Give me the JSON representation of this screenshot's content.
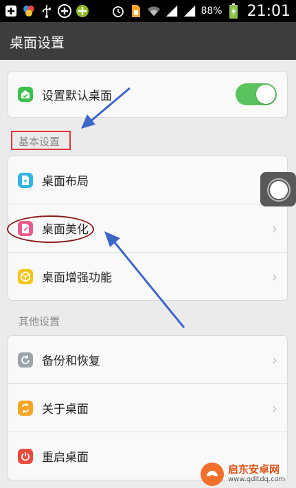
{
  "status_bar": {
    "battery_percent": "88%",
    "time": "21:01",
    "icons": [
      "plus-square-icon",
      "color-dots-icon",
      "usb-icon",
      "plus-circle-icon",
      "game-icon",
      "alarm-icon",
      "sim-icon",
      "wifi-icon",
      "signal-icon",
      "battery-icon"
    ]
  },
  "titlebar": {
    "title": "桌面设置"
  },
  "default_desktop": {
    "label": "设置默认桌面",
    "toggle_on": true,
    "icon": "home-icon",
    "icon_color": "#3cc14b"
  },
  "basic_settings": {
    "header": "基本设置",
    "items": [
      {
        "label": "桌面布局",
        "icon": "layout-icon",
        "color": "#33b5e5"
      },
      {
        "label": "桌面美化",
        "icon": "beautify-icon",
        "color": "#ef5a8a"
      },
      {
        "label": "桌面增强功能",
        "icon": "cube-icon",
        "color": "#f5c518"
      }
    ]
  },
  "other_settings": {
    "header": "其他设置",
    "items": [
      {
        "label": "备份和恢复",
        "icon": "backup-icon",
        "color": "#9aa4ad"
      },
      {
        "label": "关于桌面",
        "icon": "about-icon",
        "color": "#f5a623"
      },
      {
        "label": "重启桌面",
        "icon": "power-icon",
        "color": "#e84c3d"
      }
    ]
  },
  "chevron": "›",
  "watermark": {
    "title": "启东安卓网",
    "url": "www.qdltdq.com"
  }
}
